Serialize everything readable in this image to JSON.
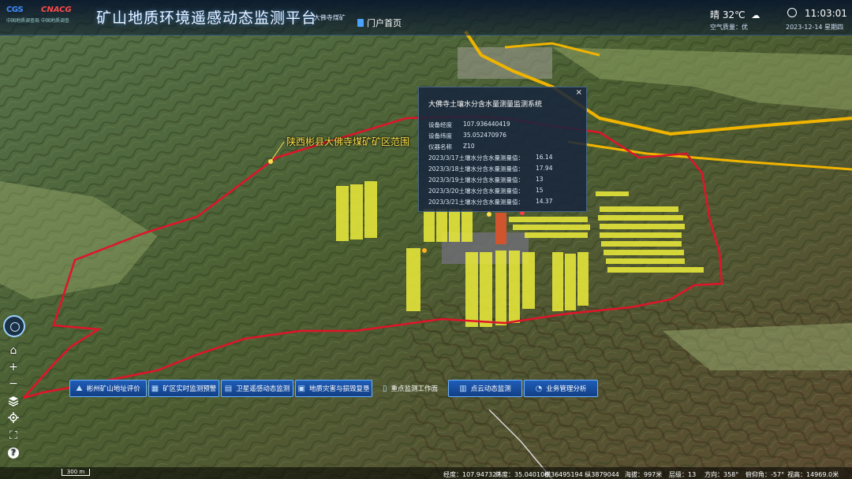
{
  "header": {
    "logo_cgs": "CGS",
    "logo_cnacg": "CNACG",
    "logo_cgs_sub": "中国地质调查局",
    "logo_cnacg_sub": "中国地质调查",
    "title": "矿山地质环境遥感动态监测平台",
    "subtitle": "--大佛寺煤矿",
    "portal_label": "门户首页",
    "weather": "晴 32℃",
    "weather_icon": "cloud-icon",
    "air_quality": "空气质量：优",
    "time": "11:03:01",
    "date": "2023-12-14 星期四"
  },
  "popup": {
    "title": "大佛寺土壤水分含水量测量监测系统",
    "close": "×",
    "longitude_label": "设备经度",
    "longitude": "107.936440419",
    "latitude_label": "设备纬度",
    "latitude": "35.052470976",
    "instrument_label": "仪器名称",
    "instrument": "Z10",
    "measurements": [
      {
        "label": "2023/3/17土壤水分含水量测量值：",
        "value": "16.14"
      },
      {
        "label": "2023/3/18土壤水分含水量测量值：",
        "value": "17.94"
      },
      {
        "label": "2023/3/19土壤水分含水量测量值：",
        "value": "13"
      },
      {
        "label": "2023/3/20土壤水分含水量测量值：",
        "value": "15"
      },
      {
        "label": "2023/3/21土壤水分含水量测量值：",
        "value": "14.37"
      }
    ]
  },
  "map": {
    "region_label": "陕西彬县大佛寺煤矿矿区范围",
    "boundary_color": "#e0142a",
    "parcel_color": "#e8e83a",
    "road_color": "#f0b400"
  },
  "toolbar": {
    "compass": "compass-icon",
    "home": "⌂",
    "zoom_in": "+",
    "zoom_out": "−",
    "layers": "layers-icon",
    "locate": "locate-icon",
    "fullscreen": "⛶",
    "help": "?"
  },
  "bottom_buttons": [
    {
      "label": "彬州矿山地址评价",
      "icon": "⛰"
    },
    {
      "label": "矿区实时监测预警",
      "icon": "▦"
    },
    {
      "label": "卫星遥感动态监测",
      "icon": "▤"
    },
    {
      "label": "地质灾害与损毁复垦",
      "icon": "▣"
    },
    {
      "label": "重点监测工作面",
      "icon": "▯"
    },
    {
      "label": "点云动态监测",
      "icon": "▥"
    },
    {
      "label": "业务管理分析",
      "icon": "◔"
    }
  ],
  "status": {
    "scale": "300 m",
    "lon": "经度：107.947327",
    "lat": "纬度：35.040106",
    "proj": "横36495194 纵3879044",
    "alt": "海拔：997米",
    "level": "层级：13",
    "heading": "方向：358°",
    "pitch": "俯仰角：-57°",
    "height": "视高：14969.0米"
  }
}
